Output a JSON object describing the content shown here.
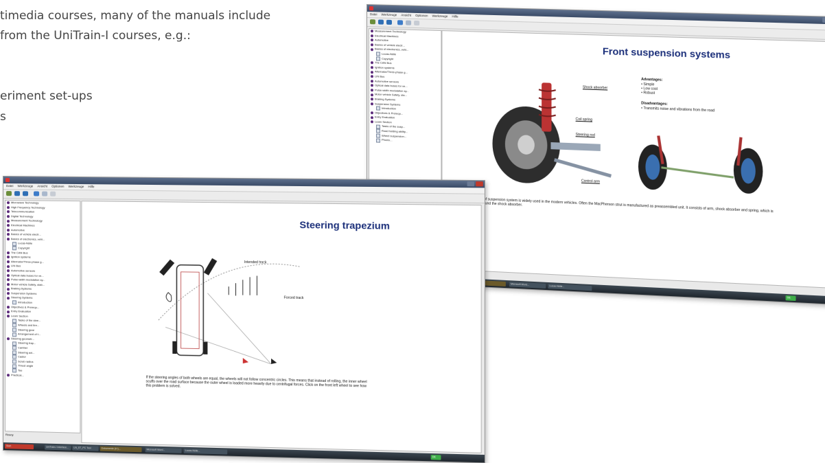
{
  "background_text": {
    "line1": "timedia courses, many of the manuals include",
    "line2": " from the UniTrain-I courses, e.g.:",
    "line3": "eriment set-ups",
    "line4": "s"
  },
  "window_back": {
    "menu": [
      "Datei",
      "Werkzeuge",
      "Ansicht",
      "Optionen",
      "Werkzeuge",
      "Hilfe"
    ],
    "tree_items": [
      {
        "label": "Measurement Technology",
        "icon": "module-icon"
      },
      {
        "label": "Electrical Machines",
        "icon": "module-icon"
      },
      {
        "label": "Automotive",
        "icon": "module-icon"
      },
      {
        "label": "Basics of vehicle electr...",
        "icon": "module-icon"
      },
      {
        "label": "Basics of electronics, vehi...",
        "icon": "module-icon"
      },
      {
        "label": "Lucas-Nülle",
        "icon": "page-icon"
      },
      {
        "label": "Copyright",
        "icon": "page-icon"
      },
      {
        "label": "The CAN Bus",
        "icon": "module-icon"
      },
      {
        "label": "Ignition systems",
        "icon": "module-icon"
      },
      {
        "label": "Alternator/Three-phase g...",
        "icon": "module-icon"
      },
      {
        "label": "LIN Bus",
        "icon": "module-icon"
      },
      {
        "label": "Automotive sensors",
        "icon": "module-icon"
      },
      {
        "label": "Optical data buses for ve...",
        "icon": "module-icon"
      },
      {
        "label": "Pulse-width modulation sy...",
        "icon": "module-icon"
      },
      {
        "label": "Motor vehicle Safety, sta...",
        "icon": "module-icon"
      },
      {
        "label": "Braking Systems",
        "icon": "module-icon"
      },
      {
        "label": "Suspension Systems",
        "icon": "module-icon"
      },
      {
        "label": "Introduction",
        "icon": "page-icon"
      },
      {
        "label": "Objectives & Prerequ...",
        "icon": "module-icon"
      },
      {
        "label": "Entry Evaluation",
        "icon": "module-icon"
      },
      {
        "label": "Learn Section",
        "icon": "module-icon"
      },
      {
        "label": "Tasks of the susp...",
        "icon": "page-icon"
      },
      {
        "label": "Road holding ability...",
        "icon": "page-icon"
      },
      {
        "label": "Wheel suspension...",
        "icon": "page-icon"
      },
      {
        "label": "Phonix...",
        "icon": "page-icon"
      }
    ],
    "page_title": "Front suspension systems",
    "labels": {
      "shock_absorber": "Shock absorber",
      "coil_spring": "Coil spring",
      "steering_rod": "Steering rod",
      "control_arm": "Control arm"
    },
    "advantages_title": "Advantages:",
    "advantages": [
      "Simple",
      "Low cost",
      "Robust"
    ],
    "disadvantages_title": "Disadvantages:",
    "disadvantages": [
      "Transmits noise and vibrations from the road"
    ],
    "description": "This type of suspension system is widely used in the modern vehicles. Often the MacPherson strut is manufactured as preassembled unit. It consists of arm, shock absorber and spring, which is wound around the shock absorber."
  },
  "window_front": {
    "menu": [
      "Datei",
      "Werkzeuge",
      "Ansicht",
      "Optionen",
      "Werkzeuge",
      "Hilfe"
    ],
    "tree_items": [
      {
        "label": "Microwave Technology",
        "icon": "module-icon"
      },
      {
        "label": "High Frequency Technology",
        "icon": "module-icon"
      },
      {
        "label": "Telecommunication",
        "icon": "module-icon"
      },
      {
        "label": "Digital Technology",
        "icon": "module-icon"
      },
      {
        "label": "Measurement Technology",
        "icon": "module-icon"
      },
      {
        "label": "Electrical Machines",
        "icon": "module-icon"
      },
      {
        "label": "Automotive",
        "icon": "module-icon"
      },
      {
        "label": "Basics of vehicle electr...",
        "icon": "module-icon"
      },
      {
        "label": "Basics of electronics, vehi...",
        "icon": "module-icon"
      },
      {
        "label": "Lucas-Nülle",
        "icon": "page-icon"
      },
      {
        "label": "Copyright",
        "icon": "page-icon"
      },
      {
        "label": "The CAN Bus",
        "icon": "module-icon"
      },
      {
        "label": "Ignition systems",
        "icon": "module-icon"
      },
      {
        "label": "Alternator/Three-phase g...",
        "icon": "module-icon"
      },
      {
        "label": "LIN Bus",
        "icon": "module-icon"
      },
      {
        "label": "Automotive sensors",
        "icon": "module-icon"
      },
      {
        "label": "Optical data buses for ve...",
        "icon": "module-icon"
      },
      {
        "label": "Pulse-width modulation sy...",
        "icon": "module-icon"
      },
      {
        "label": "Motor vehicle Safety, stab...",
        "icon": "module-icon"
      },
      {
        "label": "Braking Systems",
        "icon": "module-icon"
      },
      {
        "label": "Suspension Systems",
        "icon": "module-icon"
      },
      {
        "label": "Steering Systems",
        "icon": "module-icon"
      },
      {
        "label": "Introduction",
        "icon": "page-icon"
      },
      {
        "label": "Objectives & Prerequ...",
        "icon": "module-icon"
      },
      {
        "label": "Entry Evaluation",
        "icon": "module-icon"
      },
      {
        "label": "Learn Section",
        "icon": "module-icon"
      },
      {
        "label": "Tasks of the stee...",
        "icon": "page-icon"
      },
      {
        "label": "Wheels and tire...",
        "icon": "page-icon"
      },
      {
        "label": "Steering gear",
        "icon": "page-icon"
      },
      {
        "label": "Arrangement of t...",
        "icon": "page-icon"
      },
      {
        "label": "Steering geometr...",
        "icon": "module-icon"
      },
      {
        "label": "Steering trap...",
        "icon": "page-icon"
      },
      {
        "label": "Camber",
        "icon": "page-icon"
      },
      {
        "label": "Steering axi...",
        "icon": "page-icon"
      },
      {
        "label": "Castor",
        "icon": "page-icon"
      },
      {
        "label": "Scrub radius",
        "icon": "page-icon"
      },
      {
        "label": "Thrust angle",
        "icon": "page-icon"
      },
      {
        "label": "Toe",
        "icon": "page-icon"
      },
      {
        "label": "Practical...",
        "icon": "module-icon"
      }
    ],
    "page_title": "Steering trapezium",
    "labels": {
      "intended_track": "Intended track",
      "forced_track": "Forced track"
    },
    "description": "If the steering angles of both wheels are equal, the wheels will not follow concentric circles. This means that instead of rolling, the inner wheel scuffs over the road surface because the outer wheel is loaded more heavily due to centrifugal forces. Click on the front left wheel to see how this problem is solved.",
    "status": "Ready"
  },
  "taskbar": {
    "items": [
      "Start",
      "UniTrain-I Interface...",
      "LN_ST_PC Tool",
      "Dokumente (H:)...",
      "Microsoft Word...",
      "Lucas-Nülle..."
    ],
    "lang": "DE",
    "accent": "#3fae49"
  },
  "colors": {
    "title_blue": "#1b2f7a",
    "tree_icon": "#5b2a7a",
    "title_bar": "#3a4b67"
  }
}
